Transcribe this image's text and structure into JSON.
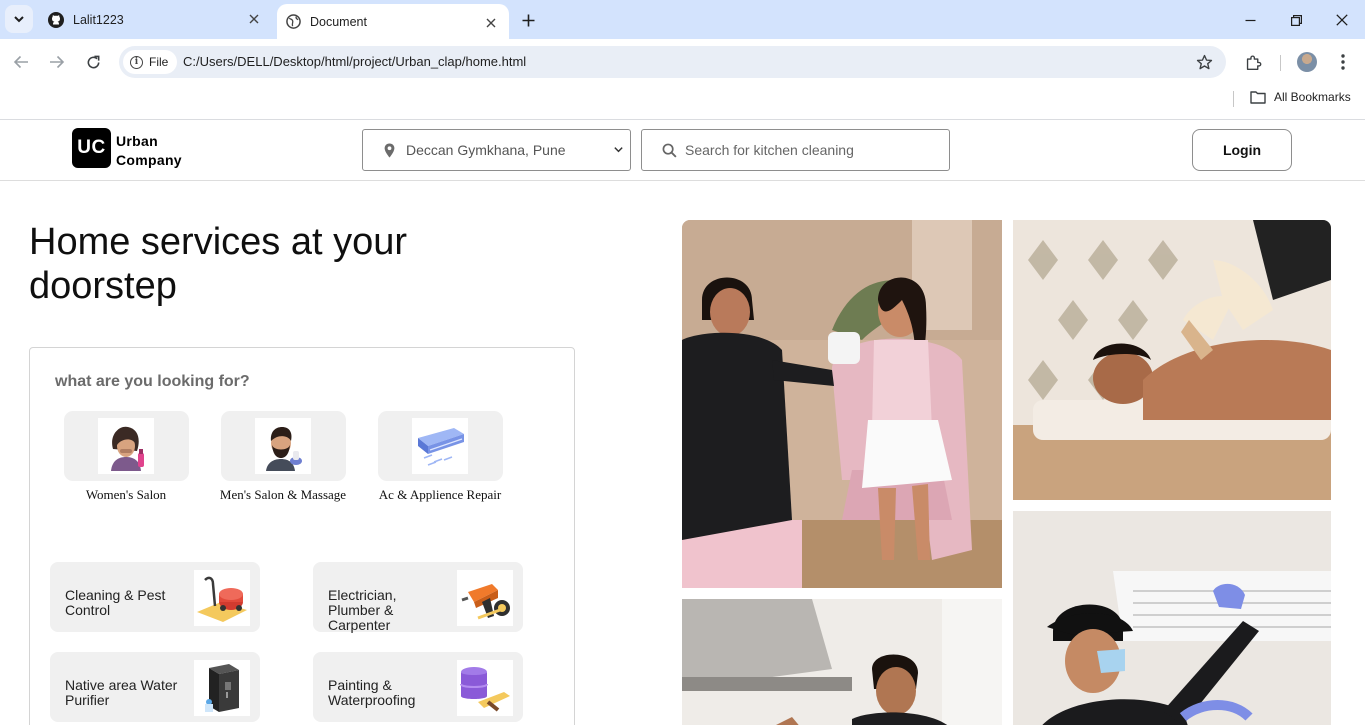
{
  "browser": {
    "tabs": [
      {
        "title": "Lalit1223",
        "icon": "github-icon"
      },
      {
        "title": "Document",
        "icon": "globe-icon"
      }
    ],
    "url_chip": "File",
    "url": "C:/Users/DELL/Desktop/html/project/Urban_clap/home.html",
    "bookmarks_label": "All Bookmarks"
  },
  "header": {
    "logo_mark": "UC",
    "logo_line1": "Urban",
    "logo_line2": "Company",
    "location": "Deccan Gymkhana, Pune",
    "search_placeholder": "Search for kitchen cleaning",
    "login_label": "Login"
  },
  "hero": {
    "title": "Home services at your doorstep"
  },
  "services": {
    "question": "what are you looking for?",
    "categories": [
      {
        "label": "Women's Salon",
        "icon": "women-salon-icon"
      },
      {
        "label": "Men's Salon & Massage",
        "icon": "men-salon-icon"
      },
      {
        "label": "Ac & Applience Repair",
        "icon": "ac-repair-icon"
      }
    ],
    "wide_categories": [
      {
        "label": "Cleaning & Pest Control",
        "icon": "vacuum-cleaner-icon"
      },
      {
        "label": "Electrician, Plumber & Carpenter",
        "icon": "drill-icon"
      },
      {
        "label": "Native area Water Purifier",
        "icon": "water-purifier-icon"
      },
      {
        "label": "Painting & Waterproofing",
        "icon": "paint-roller-icon"
      }
    ]
  },
  "colors": {
    "tabbar_bg": "#d3e3fd",
    "omnibox_bg": "#e9eef6",
    "tile_bg": "#f0f0f0",
    "logo_bg": "#000000"
  }
}
